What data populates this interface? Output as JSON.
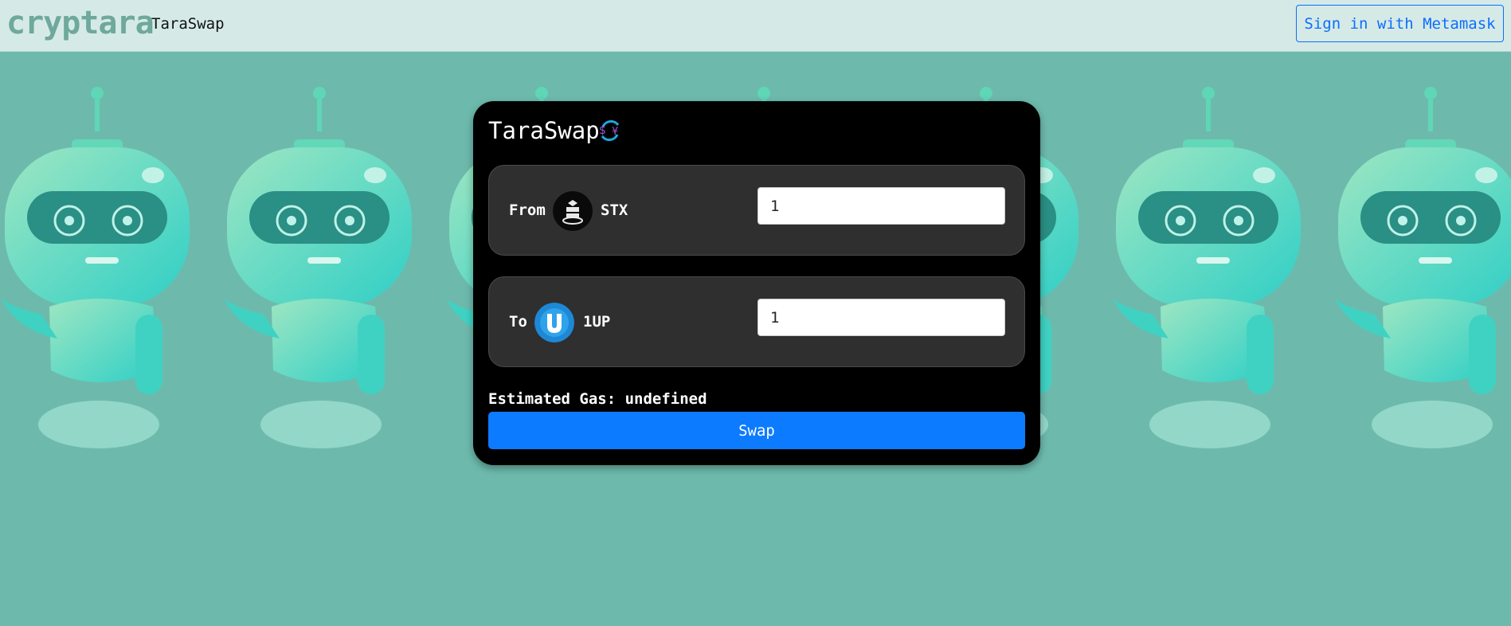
{
  "navbar": {
    "brand": "cryptara",
    "link_label": "TaraSwap",
    "signin_label": "Sign in with Metamask"
  },
  "card": {
    "title": "TaraSwap",
    "title_icon": "currency-swap-icon",
    "from": {
      "label": "From",
      "token_icon": "stx-token-icon",
      "token": "STX",
      "amount": "1"
    },
    "to": {
      "label": "To",
      "token_icon": "1up-token-icon",
      "token": "1UP",
      "amount": "1"
    },
    "gas_label": "Estimated Gas: undefined",
    "swap_label": "Swap"
  },
  "colors": {
    "page_background": "#6dbaad",
    "navbar_background": "#d5eae6",
    "accent": "#0d6efd",
    "swap_button": "#0d7bff",
    "card_background": "#000000",
    "panel_background": "#2f2f2f"
  }
}
